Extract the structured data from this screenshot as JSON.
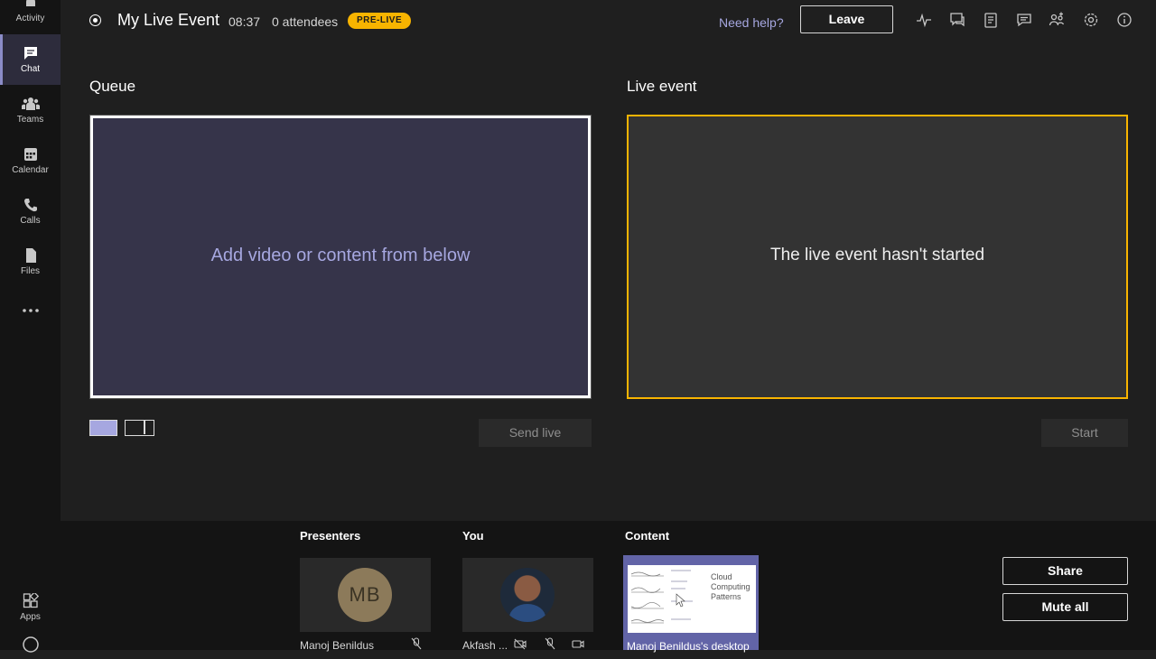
{
  "rail": {
    "items": [
      {
        "label": "Activity"
      },
      {
        "label": "Chat"
      },
      {
        "label": "Teams"
      },
      {
        "label": "Calendar"
      },
      {
        "label": "Calls"
      },
      {
        "label": "Files"
      },
      {
        "label": "Apps"
      }
    ],
    "accent": "#8b8cc7"
  },
  "header": {
    "title": "My Live Event",
    "time": "08:37",
    "attendees": "0 attendees",
    "status_badge": "PRE-LIVE",
    "help_link": "Need help?",
    "leave_label": "Leave",
    "icons": [
      "health-icon",
      "qa-icon",
      "notes-icon",
      "chat-icon",
      "participants-icon",
      "settings-icon",
      "info-icon"
    ]
  },
  "queue": {
    "label": "Queue",
    "placeholder": "Add video or content from below",
    "send_live_label": "Send live"
  },
  "live": {
    "label": "Live event",
    "status": "The live event hasn't started",
    "start_label": "Start",
    "border_color": "#f8b400"
  },
  "bottom": {
    "presenters_label": "Presenters",
    "you_label": "You",
    "content_label": "Content",
    "presenter": {
      "initials": "MB",
      "name": "Manoj Benildus"
    },
    "you": {
      "name": "Akfash ..."
    },
    "content": {
      "name": "Manoj Benildus's desktop",
      "thumb_text": "Cloud Computing Patterns"
    },
    "share_label": "Share",
    "mute_all_label": "Mute all"
  }
}
